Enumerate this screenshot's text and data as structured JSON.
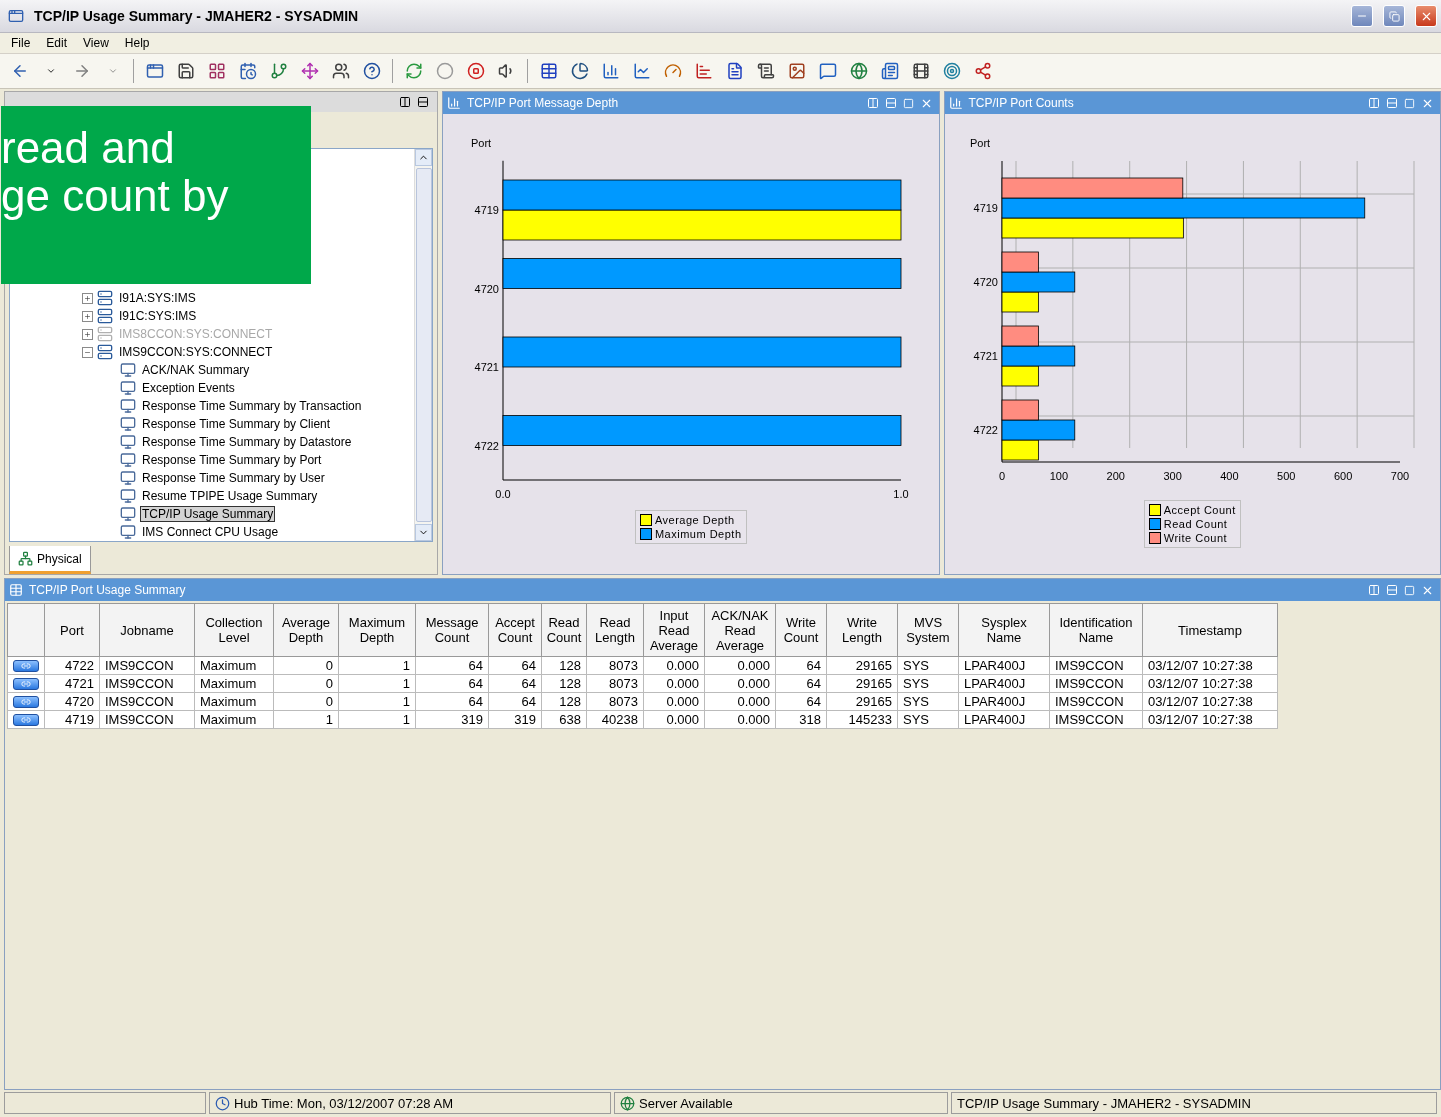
{
  "window": {
    "title": "TCP/IP Usage Summary - JMAHER2 - SYSADMIN"
  },
  "menu": [
    "File",
    "Edit",
    "View",
    "Help"
  ],
  "navigator": {
    "tree": [
      {
        "kind": "system",
        "label": "I91A:SYS:IMS",
        "expanded": false,
        "offline": false
      },
      {
        "kind": "system",
        "label": "I91C:SYS:IMS",
        "expanded": false,
        "offline": false
      },
      {
        "kind": "system",
        "label": "IMS8CCON:SYS:CONNECT",
        "expanded": false,
        "offline": true
      },
      {
        "kind": "system",
        "label": "IMS9CCON:SYS:CONNECT",
        "expanded": true,
        "offline": false,
        "children": [
          {
            "kind": "workspace",
            "label": "ACK/NAK Summary",
            "selected": false
          },
          {
            "kind": "workspace",
            "label": "Exception Events",
            "selected": false
          },
          {
            "kind": "workspace",
            "label": "Response Time Summary by Transaction",
            "selected": false
          },
          {
            "kind": "workspace",
            "label": "Response Time Summary by Client",
            "selected": false
          },
          {
            "kind": "workspace",
            "label": "Response Time Summary by Datastore",
            "selected": false
          },
          {
            "kind": "workspace",
            "label": "Response Time Summary by Port",
            "selected": false
          },
          {
            "kind": "workspace",
            "label": "Response Time Summary by User",
            "selected": false
          },
          {
            "kind": "workspace",
            "label": "Resume TPIPE Usage Summary",
            "selected": false
          },
          {
            "kind": "workspace",
            "label": "TCP/IP Usage Summary",
            "selected": true
          },
          {
            "kind": "workspace",
            "label": "IMS Connect CPU Usage",
            "selected": false
          }
        ]
      }
    ],
    "tabs": [
      {
        "label": "Physical",
        "selected": true
      }
    ]
  },
  "callout": {
    "lines": [
      "read and",
      "ge count by"
    ]
  },
  "charts": [
    {
      "title": "TCP/IP Port Message Depth",
      "chart_data": {
        "type": "bar",
        "orientation": "horizontal",
        "legend": true,
        "ylabel": "Port",
        "categories": [
          "4719",
          "4720",
          "4721",
          "4722"
        ],
        "series": [
          {
            "name": "Average Depth",
            "color": "#ffff00",
            "values": [
              1,
              0,
              0,
              0
            ]
          },
          {
            "name": "Maximum Depth",
            "color": "#0099ff",
            "values": [
              1,
              1,
              1,
              1
            ]
          }
        ],
        "xlim": [
          0,
          1
        ],
        "xticks": [
          {
            "value": 0,
            "label": "0.0"
          },
          {
            "value": 1,
            "label": "1.0"
          }
        ]
      }
    },
    {
      "title": "TCP/IP Port Counts",
      "chart_data": {
        "type": "bar",
        "orientation": "horizontal",
        "legend": true,
        "ylabel": "Port",
        "categories": [
          "4719",
          "4720",
          "4721",
          "4722"
        ],
        "series": [
          {
            "name": "Accept Count",
            "color": "#ffff00",
            "values": [
              319,
              64,
              64,
              64
            ]
          },
          {
            "name": "Read Count",
            "color": "#0099ff",
            "values": [
              638,
              128,
              128,
              128
            ]
          },
          {
            "name": "Write Count",
            "color": "#ff8c80",
            "values": [
              318,
              64,
              64,
              64
            ]
          }
        ],
        "xlim": [
          0,
          700
        ],
        "xticks": [
          0,
          100,
          200,
          300,
          400,
          500,
          600,
          700
        ]
      }
    }
  ],
  "table": {
    "title": "TCP/IP Port Usage Summary",
    "columns": [
      "Port",
      "Jobname",
      "Collection\nLevel",
      "Average\nDepth",
      "Maximum\nDepth",
      "Message\nCount",
      "Accept\nCount",
      "Read\nCount",
      "Read\nLength",
      "Input\nRead\nAverage",
      "ACK/NAK\nRead\nAverage",
      "Write\nCount",
      "Write\nLength",
      "MVS\nSystem",
      "Sysplex\nName",
      "Identification\nName",
      "Timestamp"
    ],
    "rows": [
      [
        "4722",
        "IMS9CCON",
        "Maximum",
        "0",
        "1",
        "64",
        "64",
        "128",
        "8073",
        "0.000",
        "0.000",
        "64",
        "29165",
        "SYS",
        "LPAR400J",
        "IMS9CCON",
        "03/12/07 10:27:38"
      ],
      [
        "4721",
        "IMS9CCON",
        "Maximum",
        "0",
        "1",
        "64",
        "64",
        "128",
        "8073",
        "0.000",
        "0.000",
        "64",
        "29165",
        "SYS",
        "LPAR400J",
        "IMS9CCON",
        "03/12/07 10:27:38"
      ],
      [
        "4720",
        "IMS9CCON",
        "Maximum",
        "0",
        "1",
        "64",
        "64",
        "128",
        "8073",
        "0.000",
        "0.000",
        "64",
        "29165",
        "SYS",
        "LPAR400J",
        "IMS9CCON",
        "03/12/07 10:27:38"
      ],
      [
        "4719",
        "IMS9CCON",
        "Maximum",
        "1",
        "1",
        "319",
        "319",
        "638",
        "40238",
        "0.000",
        "0.000",
        "318",
        "145233",
        "SYS",
        "LPAR400J",
        "IMS9CCON",
        "03/12/07 10:27:38"
      ]
    ]
  },
  "status_bar": {
    "hub_time": "Hub Time: Mon, 03/12/2007 07:28 AM",
    "server": "Server Available",
    "workspace": "TCP/IP Usage Summary - JMAHER2 - SYSADMIN"
  }
}
